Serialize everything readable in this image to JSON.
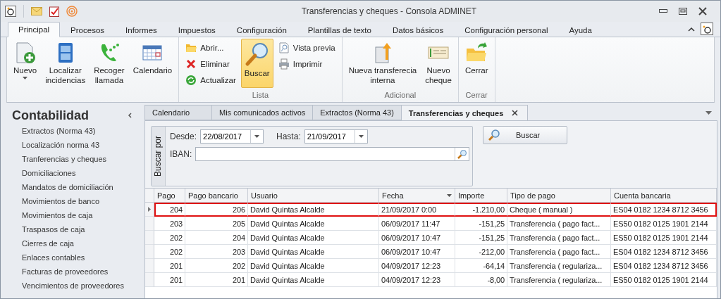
{
  "window": {
    "title": "Transferencias y cheques - Consola ADMINET"
  },
  "ribbon": {
    "tabs": [
      {
        "label": "Principal",
        "selected": true
      },
      {
        "label": "Procesos",
        "selected": false
      },
      {
        "label": "Informes",
        "selected": false
      },
      {
        "label": "Impuestos",
        "selected": false
      },
      {
        "label": "Configuración",
        "selected": false
      },
      {
        "label": "Plantillas de texto",
        "selected": false
      },
      {
        "label": "Datos básicos",
        "selected": false
      },
      {
        "label": "Configuración personal",
        "selected": false
      },
      {
        "label": "Ayuda",
        "selected": false
      }
    ],
    "groups": [
      {
        "items": [
          {
            "label": "Nuevo",
            "kind": "dropdown",
            "pressed": false
          },
          {
            "label": "Localizar\nincidencias",
            "kind": "large",
            "pressed": false
          },
          {
            "label": "Recoger\nllamada",
            "kind": "large",
            "pressed": false
          },
          {
            "label": "Calendario",
            "kind": "large",
            "pressed": false
          }
        ]
      },
      {
        "label": "Lista",
        "items": [
          {
            "label": "Abrir...",
            "kind": "small",
            "pressed": false
          },
          {
            "label": "Eliminar",
            "kind": "small",
            "pressed": false
          },
          {
            "label": "Actualizar",
            "kind": "small",
            "pressed": false
          },
          {
            "label": "Buscar",
            "kind": "large",
            "pressed": true
          },
          {
            "label": "Vista previa",
            "kind": "small",
            "pressed": false
          },
          {
            "label": "Imprimir",
            "kind": "small",
            "pressed": false
          }
        ]
      },
      {
        "label": "Adicional",
        "items": [
          {
            "label": "Nueva transferecia\ninterna",
            "kind": "large",
            "pressed": false
          },
          {
            "label": "Nuevo\ncheque",
            "kind": "large",
            "pressed": false
          }
        ]
      },
      {
        "label": "Cerrar",
        "items": [
          {
            "label": "Cerrar",
            "kind": "large",
            "pressed": false
          }
        ]
      }
    ]
  },
  "sidebar": {
    "title": "Contabilidad",
    "items": [
      "Extractos (Norma 43)",
      "Localización norma 43",
      "Tranferencias y cheques",
      "Domiciliaciones",
      "Mandatos de domiciliación",
      "Movimientos de banco",
      "Movimientos de caja",
      "Traspasos de caja",
      "Cierres de caja",
      "Enlaces contables",
      "Facturas de proveedores",
      "Vencimientos de proveedores"
    ]
  },
  "document_tabs": [
    {
      "label": "Calendario",
      "selected": false
    },
    {
      "label": "Mis comunicados activos",
      "selected": false
    },
    {
      "label": "Extractos (Norma 43)",
      "selected": false
    },
    {
      "label": "Transferencias y cheques",
      "selected": true
    }
  ],
  "filter": {
    "group_label": "Buscar por",
    "desde_label": "Desde:",
    "desde": "22/08/2017",
    "hasta_label": "Hasta:",
    "hasta": "21/09/2017",
    "iban_label": "IBAN:",
    "search_button": "Buscar"
  },
  "table": {
    "columns": [
      {
        "label": "Pago",
        "sorted": false
      },
      {
        "label": "Pago bancario",
        "sorted": false
      },
      {
        "label": "Usuario",
        "sorted": false
      },
      {
        "label": "Fecha",
        "sorted": true
      },
      {
        "label": "Importe",
        "sorted": false
      },
      {
        "label": "Tipo de pago",
        "sorted": false
      },
      {
        "label": "Cuenta bancaria",
        "sorted": false
      }
    ],
    "rows": [
      {
        "selected": true,
        "cells": [
          "204",
          "206",
          "David Quintas Alcalde",
          "21/09/2017 0:00",
          "-1.210,00",
          "Cheque ( manual )",
          "ES04 0182 1234 8712 3456"
        ]
      },
      {
        "selected": false,
        "cells": [
          "203",
          "205",
          "David Quintas Alcalde",
          "06/09/2017 11:47",
          "-151,25",
          "Transferencia ( pago fact...",
          "ES50 0182 0125 1901 2144"
        ]
      },
      {
        "selected": false,
        "cells": [
          "202",
          "204",
          "David Quintas Alcalde",
          "06/09/2017 10:47",
          "-151,25",
          "Transferencia ( pago fact...",
          "ES50 0182 0125 1901 2144"
        ]
      },
      {
        "selected": false,
        "cells": [
          "202",
          "203",
          "David Quintas Alcalde",
          "06/09/2017 10:47",
          "-212,00",
          "Transferencia ( pago fact...",
          "ES04 0182 1234 8712 3456"
        ]
      },
      {
        "selected": false,
        "cells": [
          "201",
          "202",
          "David Quintas Alcalde",
          "04/09/2017 12:23",
          "-64,14",
          "Transferencia ( regulariza...",
          "ES04 0182 1234 8712 3456"
        ]
      },
      {
        "selected": false,
        "cells": [
          "201",
          "201",
          "David Quintas Alcalde",
          "04/09/2017 12:23",
          "-8,00",
          "Transferencia ( regulariza...",
          "ES50 0182 0125 1901 2144"
        ]
      }
    ]
  }
}
